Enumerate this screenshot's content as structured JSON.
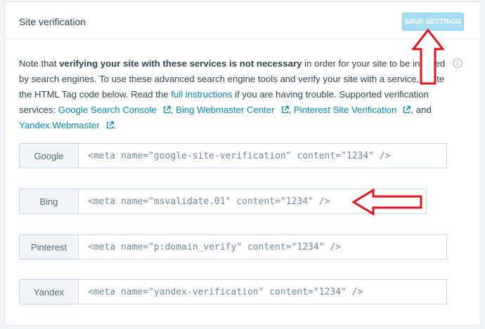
{
  "header": {
    "title": "Site verification",
    "save_label": "SAVE SETTINGS"
  },
  "description": {
    "t1": "Note that ",
    "bold": "verifying your site with these services is not necessary",
    "t2": " in order for your site to be indexed by search engines. To use these advanced search engine tools and verify your site with a service, paste the HTML Tag code below. Read the ",
    "link_instructions": "full instructions",
    "t3": " if you are having trouble. Supported verification services: ",
    "link_google": "Google Search Console",
    "sep1": ", ",
    "link_bing": "Bing Webmaster Center",
    "sep2": ", ",
    "link_pinterest": "Pinterest Site Verification",
    "sep3": ", and ",
    "link_yandex": "Yandex.Webmaster",
    "end": "."
  },
  "services": [
    {
      "label": "Google",
      "value": "<meta name=\"google-site-verification\" content=\"1234\" />"
    },
    {
      "label": "Bing",
      "value": "<meta name=\"msvalidate.01\" content=\"1234\" />"
    },
    {
      "label": "Pinterest",
      "value": "<meta name=\"p:domain_verify\" content=\"1234\" />"
    },
    {
      "label": "Yandex",
      "value": "<meta name=\"yandex-verification\" content=\"1234\" />"
    }
  ],
  "icons": {
    "external": "external-link-icon",
    "info": "info-icon",
    "annotation": "red-arrow"
  },
  "colors": {
    "link": "#0087be",
    "button": "#a6ddf4",
    "arrow": "#e4131b"
  }
}
